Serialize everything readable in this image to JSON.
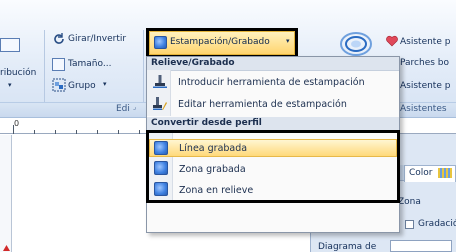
{
  "ribbon": {
    "girar_invertir": "Girar/Invertir",
    "tamano": "Tamaño...",
    "grupo": "Grupo",
    "atribucion_partial": "ribución",
    "edicion_partial": "Edi",
    "estampacion_grabado": "Estampación/Grabado",
    "asistente_1": "Asistente p",
    "parches": "Parches bo",
    "asistente_2": "Asistente p",
    "asistentes": "Asistentes"
  },
  "menu": {
    "section_relieve": "Relieve/Grabado",
    "items_relieve": [
      {
        "label": "Introducir herramienta de estampación",
        "icon": "stamp-tool-icon"
      },
      {
        "label": "Editar herramienta de estampación",
        "icon": "edit-stamp-icon"
      }
    ],
    "section_convertir": "Convertir desde perfil",
    "items_convertir": [
      {
        "label": "Línea grabada",
        "icon": "engraved-line-icon"
      },
      {
        "label": "Zona grabada",
        "icon": "engraved-area-icon"
      },
      {
        "label": "Zona en relieve",
        "icon": "embossed-area-icon"
      }
    ]
  },
  "ruler": {
    "start_label": "0"
  },
  "panel": {
    "tab_color": "Color",
    "zona": "Zona",
    "gradacion": "Gradación",
    "diagrama": "Diagrama de"
  },
  "colors": {
    "highlight": "#ffd97a",
    "border_callout": "#000000",
    "icon_blue": "#3c7fe0"
  }
}
